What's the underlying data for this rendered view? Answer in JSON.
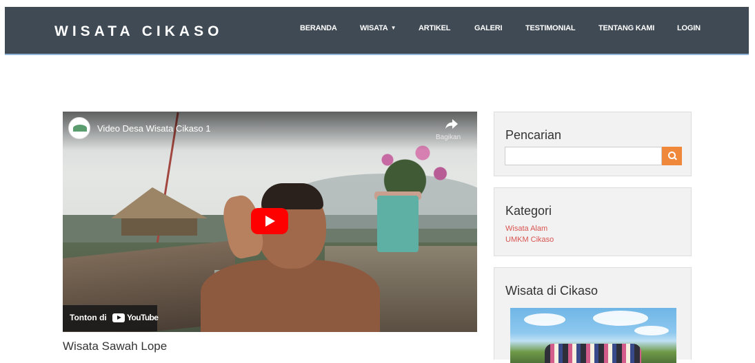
{
  "navbar": {
    "brand": "WISATA CIKASO",
    "items": [
      {
        "label": "BERANDA"
      },
      {
        "label": "WISATA",
        "has_dropdown": true
      },
      {
        "label": "ARTIKEL"
      },
      {
        "label": "GALERI"
      },
      {
        "label": "TESTIMONIAL"
      },
      {
        "label": "TENTANG KAMI"
      },
      {
        "label": "LOGIN"
      }
    ]
  },
  "video": {
    "title": "Video Desa Wisata Cikaso 1",
    "share_label": "Bagikan",
    "watch_on": "Tonton di",
    "youtube_label": "YouTube",
    "caption": "Wisata Sawah Lope"
  },
  "sidebar": {
    "search": {
      "title": "Pencarian",
      "placeholder": ""
    },
    "categories": {
      "title": "Kategori",
      "items": [
        {
          "label": "Wisata Alam"
        },
        {
          "label": "UMKM Cikaso"
        }
      ]
    },
    "wisata": {
      "title": "Wisata di Cikaso"
    }
  },
  "colors": {
    "navbar_bg": "#3f4a55",
    "accent_orange": "#f0883c",
    "link_red": "#d9534f",
    "youtube_red": "#ff0000"
  }
}
